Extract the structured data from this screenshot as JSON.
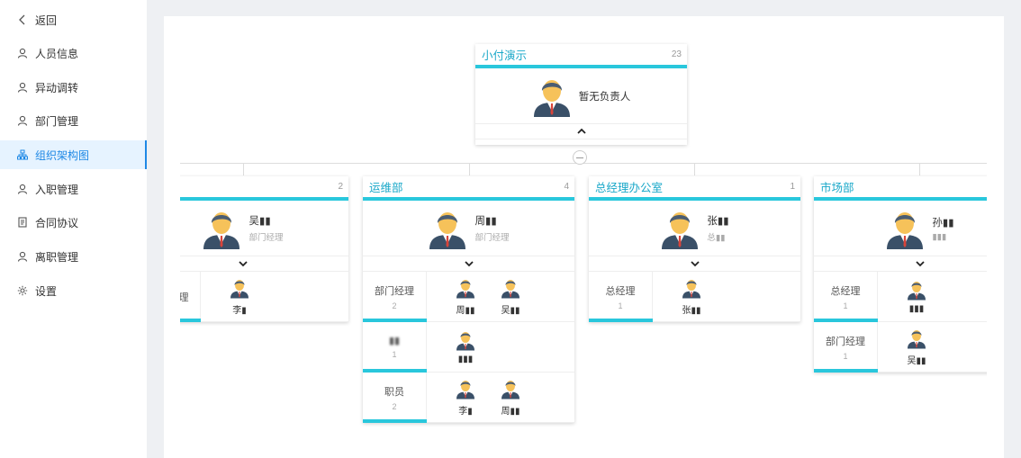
{
  "sidebar": {
    "items": [
      {
        "label": "返回",
        "icon": "back-icon"
      },
      {
        "label": "人员信息",
        "icon": "user-icon"
      },
      {
        "label": "异动调转",
        "icon": "user-icon"
      },
      {
        "label": "部门管理",
        "icon": "user-icon"
      },
      {
        "label": "组织架构图",
        "icon": "org-chart-icon",
        "active": true
      },
      {
        "label": "入职管理",
        "icon": "user-icon"
      },
      {
        "label": "合同协议",
        "icon": "document-icon"
      },
      {
        "label": "离职管理",
        "icon": "user-icon"
      },
      {
        "label": "设置",
        "icon": "gear-icon"
      }
    ]
  },
  "root": {
    "title": "小付演示",
    "count": "23",
    "leader_name": "暂无负责人"
  },
  "departments": [
    {
      "title": "",
      "count": "2",
      "leader_name": "吴▮▮",
      "leader_role": "部门经理",
      "roles": [
        {
          "label": "理",
          "count": "",
          "members": [
            "李▮"
          ]
        }
      ]
    },
    {
      "title": "运维部",
      "count": "4",
      "leader_name": "周▮▮",
      "leader_role": "部门经理",
      "roles": [
        {
          "label": "部门经理",
          "count": "2",
          "members": [
            "周▮▮",
            "吴▮▮"
          ]
        },
        {
          "label": "▮▮",
          "count": "1",
          "members": [
            "▮▮▮"
          ]
        },
        {
          "label": "职员",
          "count": "2",
          "members": [
            "李▮",
            "周▮▮"
          ]
        }
      ]
    },
    {
      "title": "总经理办公室",
      "count": "1",
      "leader_name": "张▮▮",
      "leader_role": "总▮▮",
      "roles": [
        {
          "label": "总经理",
          "count": "1",
          "members": [
            "张▮▮"
          ]
        }
      ]
    },
    {
      "title": "市场部",
      "count": "",
      "leader_name": "孙▮▮",
      "leader_role": "▮▮▮",
      "roles": [
        {
          "label": "总经理",
          "count": "1",
          "members": [
            "▮▮▮"
          ]
        },
        {
          "label": "部门经理",
          "count": "1",
          "members": [
            "吴▮▮"
          ]
        }
      ]
    }
  ],
  "colors": {
    "accent": "#29c7dc",
    "title_text": "#1aa8c9",
    "active_nav": "#1e88e5",
    "active_nav_bg": "#e6f3ff"
  }
}
